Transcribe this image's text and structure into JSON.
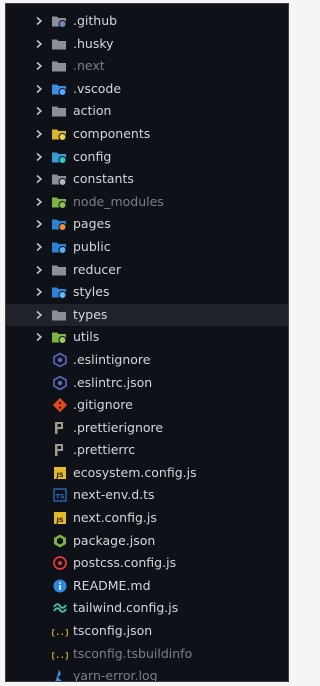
{
  "explorer": {
    "items": [
      {
        "kind": "folder",
        "label": ".github",
        "icon": "github-folder-icon",
        "color": "#8a8f99",
        "badge": "#6b8ab8",
        "dim": false
      },
      {
        "kind": "folder",
        "label": ".husky",
        "icon": "folder-icon",
        "color": "#8a8f99",
        "dim": false
      },
      {
        "kind": "folder",
        "label": ".next",
        "icon": "folder-icon",
        "color": "#8a8f99",
        "dim": true
      },
      {
        "kind": "folder",
        "label": ".vscode",
        "icon": "vscode-folder-icon",
        "color": "#3b8fe5",
        "badge": "#5aa7ff",
        "dim": false
      },
      {
        "kind": "folder",
        "label": "action",
        "icon": "folder-icon",
        "color": "#8a8f99",
        "dim": false
      },
      {
        "kind": "folder",
        "label": "components",
        "icon": "components-folder-icon",
        "color": "#d9b52c",
        "badge": "#f0d24a",
        "dim": false
      },
      {
        "kind": "folder",
        "label": "config",
        "icon": "config-folder-icon",
        "color": "#3a9ad6",
        "badge": "#2ec9c9",
        "dim": false
      },
      {
        "kind": "folder",
        "label": "constants",
        "icon": "constants-folder-icon",
        "color": "#8a8f99",
        "badge": "#b0b4bb",
        "dim": false
      },
      {
        "kind": "folder",
        "label": "node_modules",
        "icon": "node-modules-folder-icon",
        "color": "#7cb342",
        "badge": "#8bc34a",
        "dim": true
      },
      {
        "kind": "folder",
        "label": "pages",
        "icon": "pages-folder-icon",
        "color": "#2c83d6",
        "badge": "#f08c3a",
        "dim": false
      },
      {
        "kind": "folder",
        "label": "public",
        "icon": "public-folder-icon",
        "color": "#2c83d6",
        "badge": "#59b0ff",
        "dim": false
      },
      {
        "kind": "folder",
        "label": "reducer",
        "icon": "folder-icon",
        "color": "#8a8f99",
        "dim": false
      },
      {
        "kind": "folder",
        "label": "styles",
        "icon": "styles-folder-icon",
        "color": "#2c83d6",
        "badge": "#6ab7ff",
        "dim": false
      },
      {
        "kind": "folder",
        "label": "types",
        "icon": "folder-icon",
        "color": "#8a8f99",
        "dim": false,
        "selected": true
      },
      {
        "kind": "folder",
        "label": "utils",
        "icon": "utils-folder-icon",
        "color": "#7cb342",
        "badge": "#9ccc65",
        "dim": false
      },
      {
        "kind": "file",
        "label": ".eslintignore",
        "icon": "eslint-icon",
        "color": "#5c6bc0",
        "dim": false
      },
      {
        "kind": "file",
        "label": ".eslintrc.json",
        "icon": "eslint-icon",
        "color": "#5c6bc0",
        "dim": false
      },
      {
        "kind": "file",
        "label": ".gitignore",
        "icon": "git-icon",
        "color": "#e64a19",
        "dim": false
      },
      {
        "kind": "file",
        "label": ".prettierignore",
        "icon": "prettier-icon",
        "color": "#a39b8a",
        "dim": false
      },
      {
        "kind": "file",
        "label": ".prettierrc",
        "icon": "prettier-icon",
        "color": "#a39b8a",
        "dim": false
      },
      {
        "kind": "file",
        "label": "ecosystem.config.js",
        "icon": "javascript-icon",
        "color": "#e5b82a",
        "glyph": "JS",
        "dim": false
      },
      {
        "kind": "file",
        "label": "next-env.d.ts",
        "icon": "typescript-def-icon",
        "color": "#2d6cc0",
        "glyph": "TS",
        "dim": false
      },
      {
        "kind": "file",
        "label": "next.config.js",
        "icon": "javascript-icon",
        "color": "#e5b82a",
        "glyph": "JS",
        "dim": false
      },
      {
        "kind": "file",
        "label": "package.json",
        "icon": "nodejs-icon",
        "color": "#7cb342",
        "dim": false
      },
      {
        "kind": "file",
        "label": "postcss.config.js",
        "icon": "postcss-icon",
        "color": "#e53935",
        "dim": false
      },
      {
        "kind": "file",
        "label": "README.md",
        "icon": "info-icon",
        "color": "#2f88e8",
        "dim": false
      },
      {
        "kind": "file",
        "label": "tailwind.config.js",
        "icon": "tailwind-icon",
        "color": "#4dc0b5",
        "dim": false
      },
      {
        "kind": "file",
        "label": "tsconfig.json",
        "icon": "json-braces-icon",
        "color": "#e5b82a",
        "glyph": "{..}",
        "dim": false
      },
      {
        "kind": "file",
        "label": "tsconfig.tsbuildinfo",
        "icon": "json-braces-icon",
        "color": "#e5b82a",
        "glyph": "{..}",
        "dim": true
      },
      {
        "kind": "file",
        "label": "yarn-error.log",
        "icon": "yarn-icon",
        "color": "#3e8ad6",
        "dim": true
      }
    ]
  }
}
